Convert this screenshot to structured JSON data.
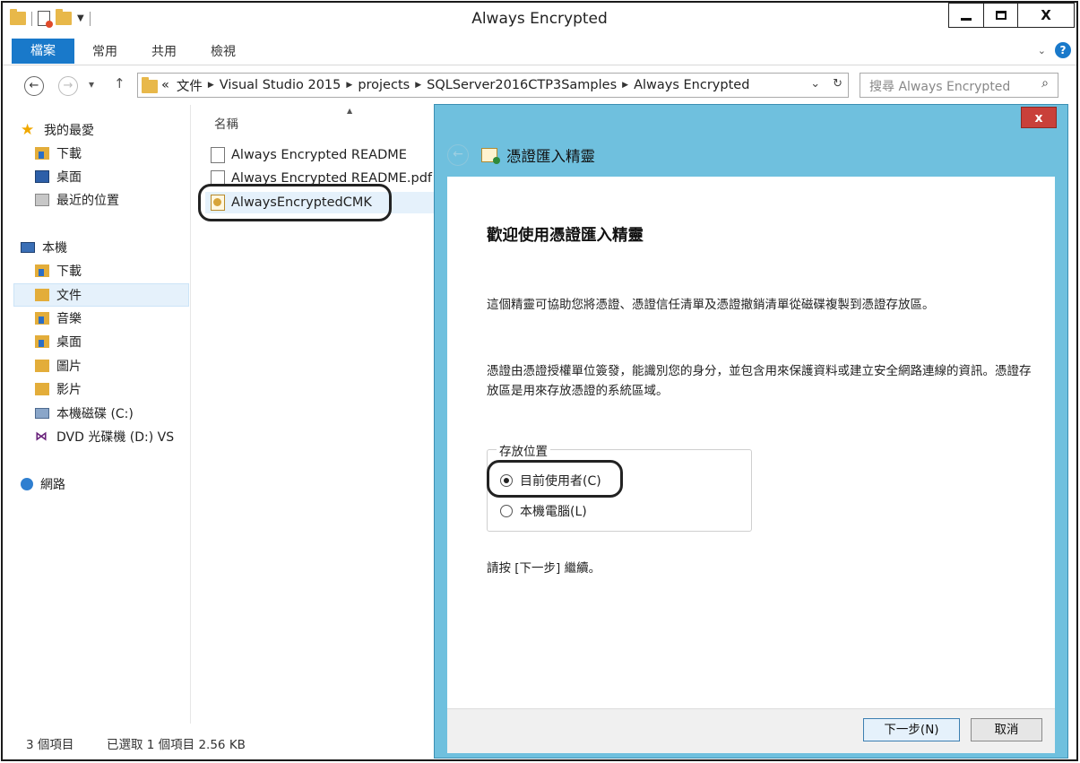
{
  "window": {
    "title": "Always Encrypted"
  },
  "ribbon": {
    "tabs": [
      "檔案",
      "常用",
      "共用",
      "檢視"
    ]
  },
  "address": {
    "overflow": "«",
    "crumbs": [
      "文件",
      "Visual Studio 2015",
      "projects",
      "SQLServer2016CTP3Samples",
      "Always Encrypted"
    ]
  },
  "search": {
    "placeholder": "搜尋 Always Encrypted"
  },
  "navpane": {
    "favorites": "我的最愛",
    "fav_items": [
      "下載",
      "桌面",
      "最近的位置"
    ],
    "thispc": "本機",
    "pc_items": [
      "下載",
      "文件",
      "音樂",
      "桌面",
      "圖片",
      "影片",
      "本機磁碟 (C:)",
      "DVD 光碟機 (D:) VS"
    ],
    "network": "網路"
  },
  "filelist": {
    "column_name": "名稱",
    "files": [
      "Always Encrypted README",
      "Always Encrypted README.pdf",
      "AlwaysEncryptedCMK"
    ]
  },
  "status": {
    "count": "3 個項目",
    "selection": "已選取 1 個項目  2.56 KB"
  },
  "wizard": {
    "close": "x",
    "header": "憑證匯入精靈",
    "title": "歡迎使用憑證匯入精靈",
    "p1": "這個精靈可協助您將憑證、憑證信任清單及憑證撤銷清單從磁碟複製到憑證存放區。",
    "p2": "憑證由憑證授權單位簽發，能識別您的身分，並包含用來保護資料或建立安全網路連線的資訊。憑證存放區是用來存放憑證的系統區域。",
    "store_group": "存放位置",
    "option_user": "目前使用者(C)",
    "option_machine": "本機電腦(L)",
    "p3": "請按 [下一步] 繼續。",
    "next": "下一步(N)",
    "cancel": "取消"
  }
}
